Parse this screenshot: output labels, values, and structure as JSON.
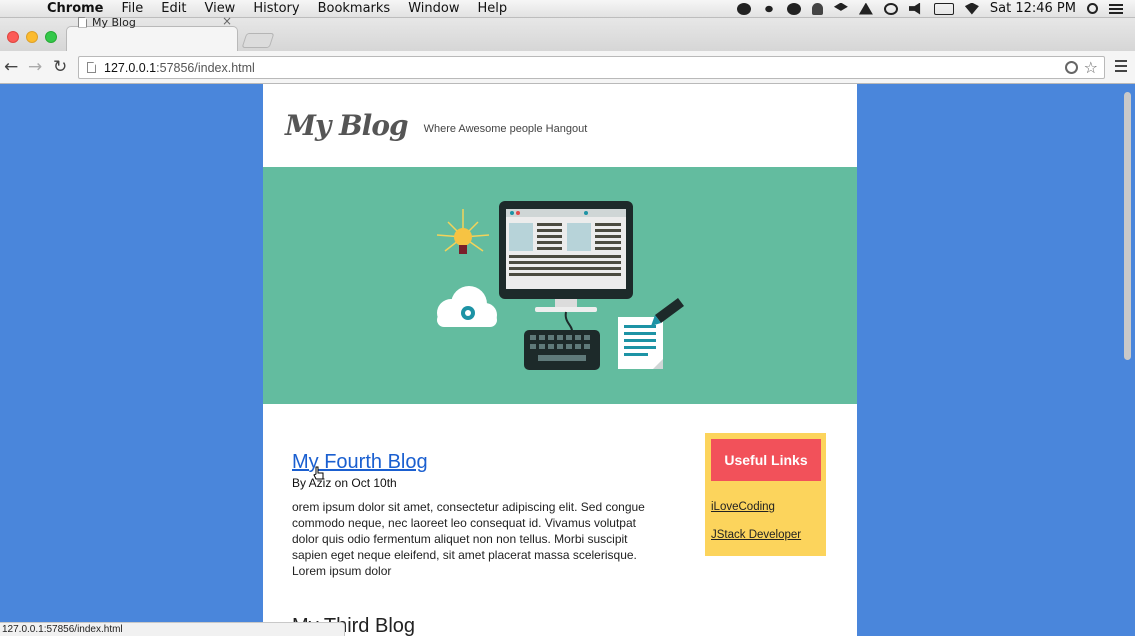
{
  "menubar": {
    "app_name": "Chrome",
    "items": [
      "File",
      "Edit",
      "View",
      "History",
      "Bookmarks",
      "Window",
      "Help"
    ],
    "clock": "Sat 12:46 PM"
  },
  "browser": {
    "tab_title": "My Blog",
    "tab_close": "×",
    "url_host": "127.0.0.1",
    "url_rest": ":57856/index.html",
    "status_url": "127.0.0.1:57856/index.html"
  },
  "site": {
    "logo": "My Blog",
    "tagline": "Where Awesome people Hangout"
  },
  "posts": [
    {
      "title": "My Fourth Blog",
      "meta": "By Aziz on Oct 10th",
      "body": "orem ipsum dolor sit amet, consectetur adipiscing elit. Sed congue commodo neque, nec laoreet leo consequat id. Vivamus volutpat dolor quis odio fermentum aliquet non non tellus. Morbi suscipit sapien eget neque eleifend, sit amet placerat massa scelerisque. Lorem ipsum dolor"
    },
    {
      "title": "My Third Blog"
    }
  ],
  "sidebar": {
    "heading": "Useful Links",
    "links": [
      "iLoveCoding",
      "JStack Developer"
    ]
  },
  "colors": {
    "background": "#4a86db",
    "hero": "#63bc9f",
    "sidebar": "#fcd45c",
    "sidebar_heading": "#f2515a",
    "link": "#1a5fd0"
  }
}
